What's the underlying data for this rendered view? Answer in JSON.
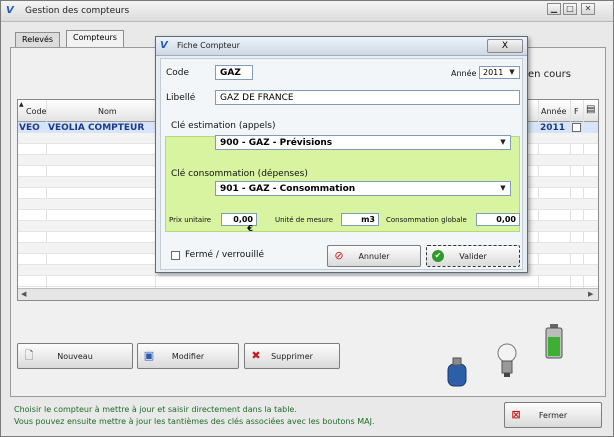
{
  "window": {
    "title": "Gestion des compteurs",
    "app_icon": "V",
    "min_label": "▁",
    "max_label": "□",
    "close_label": "✕"
  },
  "tabs": [
    {
      "label": "Relevés"
    },
    {
      "label": "Compteurs"
    }
  ],
  "status_text": "en cours",
  "table": {
    "headers": {
      "code": "Code",
      "nom": "Nom",
      "annee": "Année",
      "f": "F"
    },
    "selected_row": {
      "code": "VEO",
      "nom": "VEOLIA COMPTEUR",
      "annee": "2011"
    }
  },
  "buttons": {
    "nouveau": "Nouveau",
    "modifier": "Modifier",
    "supprimer": "Supprimer",
    "fermer": "Fermer"
  },
  "footer": {
    "line1": "Choisir le compteur à mettre à jour et saisir directement dans la table.",
    "line2": "Vous pouvez ensuite mettre à jour les tantièmes des clés associées avec les boutons MAJ."
  },
  "dialog": {
    "title": "Fiche Compteur",
    "close_label": "X",
    "code_label": "Code",
    "code_value": "GAZ",
    "annee_label": "Année",
    "annee_value": "2011",
    "libelle_label": "Libellé",
    "libelle_value": "GAZ DE FRANCE",
    "cle_estimation_label": "Clé estimation (appels)",
    "cle_estimation_value": "900 - GAZ - Prévisions",
    "cle_consommation_label": "Clé consommation (dépenses)",
    "cle_consommation_value": "901 - GAZ - Consommation",
    "prix_label": "Prix unitaire",
    "prix_value": "0,00 €",
    "unite_label": "Unité de mesure",
    "unite_value": "m3",
    "conso_label": "Consommation globale",
    "conso_value": "0,00",
    "ferme_label": "Fermé / verrouillé",
    "annuler_label": "Annuler",
    "valider_label": "Valider"
  }
}
